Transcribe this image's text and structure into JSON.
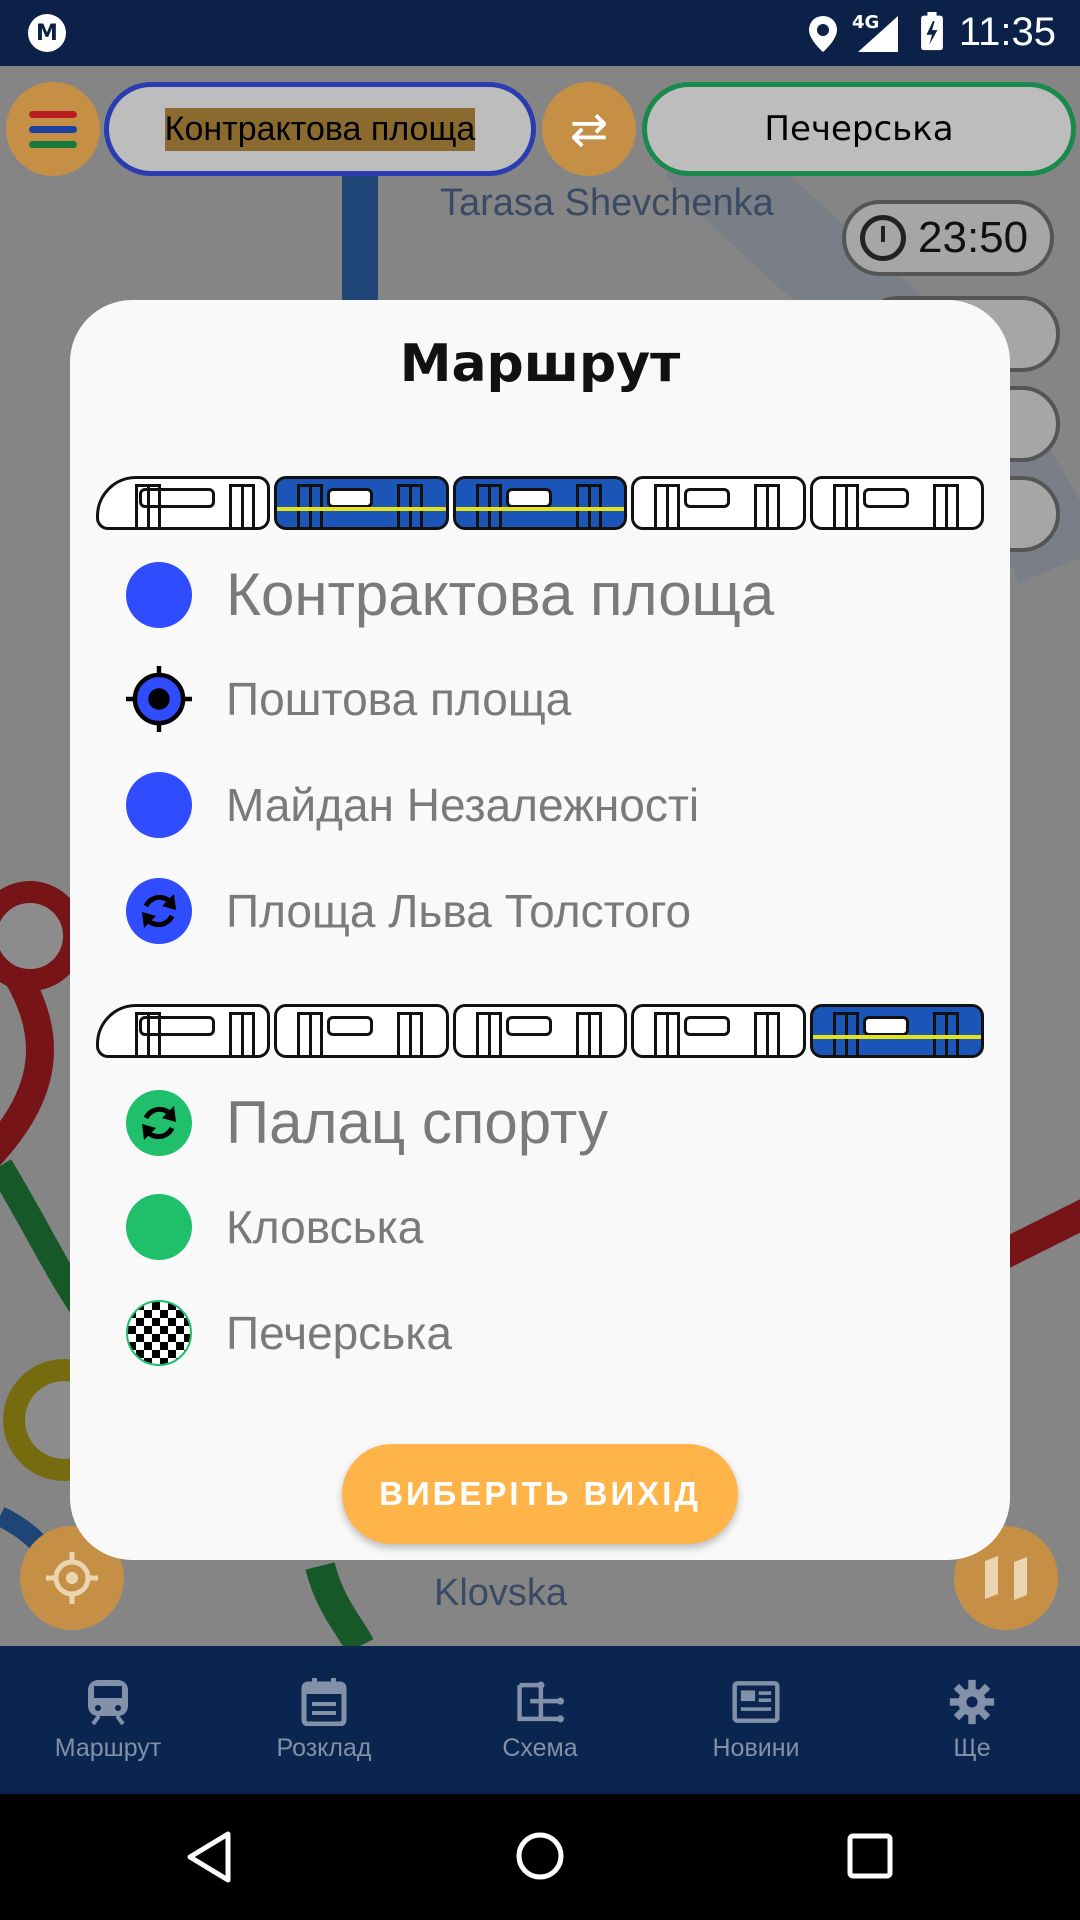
{
  "status_bar": {
    "time": "11:35",
    "network": "4G",
    "icons": [
      "metro-logo-icon",
      "location-icon",
      "signal-icon",
      "battery-charging-icon"
    ]
  },
  "top_bar": {
    "from_station": "Контрактова площа",
    "to_station": "Печерська",
    "departure_time": "23:50"
  },
  "map_labels": {
    "taras": "Tarasa Shevchenka",
    "klovska": "Klovska"
  },
  "dialog": {
    "title": "Маршрут",
    "segments": [
      {
        "line_color": "#2f4cff",
        "recommended_cars": [
          2,
          3
        ],
        "stops": [
          {
            "name": "Контрактова площа",
            "type": "start"
          },
          {
            "name": "Поштова площа",
            "type": "current"
          },
          {
            "name": "Майдан Незалежності",
            "type": "normal"
          },
          {
            "name": "Площа Льва Толстого",
            "type": "transfer"
          }
        ]
      },
      {
        "line_color": "#1fbf6b",
        "recommended_cars": [
          5
        ],
        "stops": [
          {
            "name": "Палац спорту",
            "type": "transfer"
          },
          {
            "name": "Кловська",
            "type": "normal"
          },
          {
            "name": "Печерська",
            "type": "finish"
          }
        ]
      }
    ],
    "exit_button": "ВИБЕРІТЬ ВИХІД"
  },
  "bottom_nav": [
    {
      "label": "Маршрут",
      "icon": "train-icon"
    },
    {
      "label": "Розклад",
      "icon": "calendar-icon"
    },
    {
      "label": "Схема",
      "icon": "scheme-icon"
    },
    {
      "label": "Новини",
      "icon": "news-icon"
    },
    {
      "label": "Ще",
      "icon": "gear-icon"
    }
  ],
  "colors": {
    "accent": "#ffb44a",
    "red_line": "#d9262a",
    "blue_line": "#2f4cff",
    "green_line": "#1fbf6b",
    "nav_bg": "#0a2550"
  }
}
